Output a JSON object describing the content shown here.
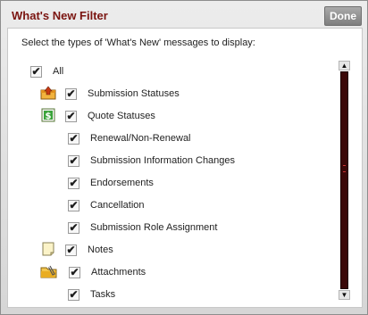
{
  "dialog": {
    "title": "What's New Filter",
    "done_label": "Done",
    "instruction": "Select the types of 'What's New' messages to display:"
  },
  "items": [
    {
      "label": "All",
      "checked": true,
      "icon": null
    },
    {
      "label": "Submission Statuses",
      "checked": true,
      "icon": "submission-status-icon"
    },
    {
      "label": "Quote Statuses",
      "checked": true,
      "icon": "dollar-icon"
    },
    {
      "label": "Renewal/Non-Renewal",
      "checked": true,
      "icon": null
    },
    {
      "label": "Submission Information Changes",
      "checked": true,
      "icon": null
    },
    {
      "label": "Endorsements",
      "checked": true,
      "icon": null
    },
    {
      "label": "Cancellation",
      "checked": true,
      "icon": null
    },
    {
      "label": "Submission Role Assignment",
      "checked": true,
      "icon": null
    },
    {
      "label": "Notes",
      "checked": true,
      "icon": "note-icon"
    },
    {
      "label": "Attachments",
      "checked": true,
      "icon": "folder-paperclip-icon"
    },
    {
      "label": "Tasks",
      "checked": true,
      "icon": null
    }
  ],
  "colors": {
    "title": "#7a1410",
    "scroll_track": "#3a0808"
  }
}
